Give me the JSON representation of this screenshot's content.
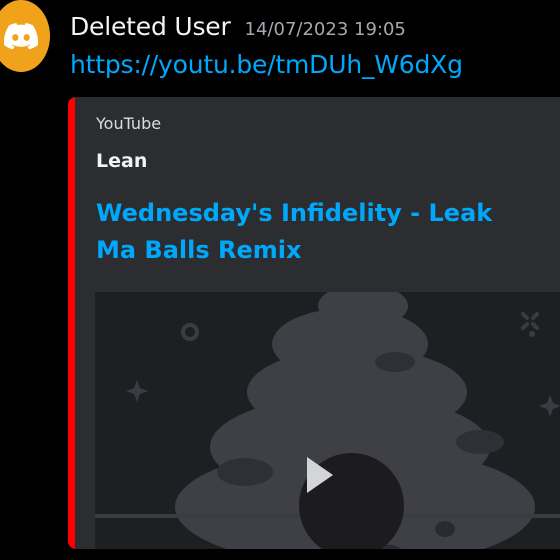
{
  "message": {
    "username": "Deleted User",
    "timestamp": "14/07/2023 19:05",
    "link": "https://youtu.be/tmDUh_W6dXg",
    "avatar_icon": "discord-logo-icon",
    "avatar_color": "#f0a21a"
  },
  "embed": {
    "provider": "YouTube",
    "author": "Lean",
    "title": "Wednesday's Infidelity - Leak Ma Balls Remix",
    "accent_color": "#ff0000",
    "thumbnail_icon": "poop-character-icon",
    "play_icon": "play-icon"
  }
}
